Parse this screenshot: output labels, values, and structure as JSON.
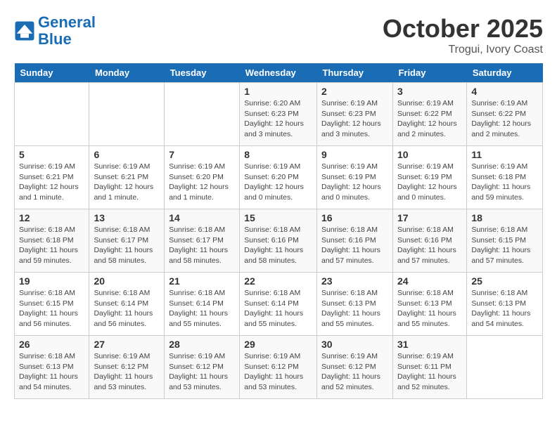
{
  "header": {
    "logo_line1": "General",
    "logo_line2": "Blue",
    "month": "October 2025",
    "location": "Trogui, Ivory Coast"
  },
  "weekdays": [
    "Sunday",
    "Monday",
    "Tuesday",
    "Wednesday",
    "Thursday",
    "Friday",
    "Saturday"
  ],
  "weeks": [
    [
      {
        "day": "",
        "info": ""
      },
      {
        "day": "",
        "info": ""
      },
      {
        "day": "",
        "info": ""
      },
      {
        "day": "1",
        "info": "Sunrise: 6:20 AM\nSunset: 6:23 PM\nDaylight: 12 hours\nand 3 minutes."
      },
      {
        "day": "2",
        "info": "Sunrise: 6:19 AM\nSunset: 6:23 PM\nDaylight: 12 hours\nand 3 minutes."
      },
      {
        "day": "3",
        "info": "Sunrise: 6:19 AM\nSunset: 6:22 PM\nDaylight: 12 hours\nand 2 minutes."
      },
      {
        "day": "4",
        "info": "Sunrise: 6:19 AM\nSunset: 6:22 PM\nDaylight: 12 hours\nand 2 minutes."
      }
    ],
    [
      {
        "day": "5",
        "info": "Sunrise: 6:19 AM\nSunset: 6:21 PM\nDaylight: 12 hours\nand 1 minute."
      },
      {
        "day": "6",
        "info": "Sunrise: 6:19 AM\nSunset: 6:21 PM\nDaylight: 12 hours\nand 1 minute."
      },
      {
        "day": "7",
        "info": "Sunrise: 6:19 AM\nSunset: 6:20 PM\nDaylight: 12 hours\nand 1 minute."
      },
      {
        "day": "8",
        "info": "Sunrise: 6:19 AM\nSunset: 6:20 PM\nDaylight: 12 hours\nand 0 minutes."
      },
      {
        "day": "9",
        "info": "Sunrise: 6:19 AM\nSunset: 6:19 PM\nDaylight: 12 hours\nand 0 minutes."
      },
      {
        "day": "10",
        "info": "Sunrise: 6:19 AM\nSunset: 6:19 PM\nDaylight: 12 hours\nand 0 minutes."
      },
      {
        "day": "11",
        "info": "Sunrise: 6:19 AM\nSunset: 6:18 PM\nDaylight: 11 hours\nand 59 minutes."
      }
    ],
    [
      {
        "day": "12",
        "info": "Sunrise: 6:18 AM\nSunset: 6:18 PM\nDaylight: 11 hours\nand 59 minutes."
      },
      {
        "day": "13",
        "info": "Sunrise: 6:18 AM\nSunset: 6:17 PM\nDaylight: 11 hours\nand 58 minutes."
      },
      {
        "day": "14",
        "info": "Sunrise: 6:18 AM\nSunset: 6:17 PM\nDaylight: 11 hours\nand 58 minutes."
      },
      {
        "day": "15",
        "info": "Sunrise: 6:18 AM\nSunset: 6:16 PM\nDaylight: 11 hours\nand 58 minutes."
      },
      {
        "day": "16",
        "info": "Sunrise: 6:18 AM\nSunset: 6:16 PM\nDaylight: 11 hours\nand 57 minutes."
      },
      {
        "day": "17",
        "info": "Sunrise: 6:18 AM\nSunset: 6:16 PM\nDaylight: 11 hours\nand 57 minutes."
      },
      {
        "day": "18",
        "info": "Sunrise: 6:18 AM\nSunset: 6:15 PM\nDaylight: 11 hours\nand 57 minutes."
      }
    ],
    [
      {
        "day": "19",
        "info": "Sunrise: 6:18 AM\nSunset: 6:15 PM\nDaylight: 11 hours\nand 56 minutes."
      },
      {
        "day": "20",
        "info": "Sunrise: 6:18 AM\nSunset: 6:14 PM\nDaylight: 11 hours\nand 56 minutes."
      },
      {
        "day": "21",
        "info": "Sunrise: 6:18 AM\nSunset: 6:14 PM\nDaylight: 11 hours\nand 55 minutes."
      },
      {
        "day": "22",
        "info": "Sunrise: 6:18 AM\nSunset: 6:14 PM\nDaylight: 11 hours\nand 55 minutes."
      },
      {
        "day": "23",
        "info": "Sunrise: 6:18 AM\nSunset: 6:13 PM\nDaylight: 11 hours\nand 55 minutes."
      },
      {
        "day": "24",
        "info": "Sunrise: 6:18 AM\nSunset: 6:13 PM\nDaylight: 11 hours\nand 55 minutes."
      },
      {
        "day": "25",
        "info": "Sunrise: 6:18 AM\nSunset: 6:13 PM\nDaylight: 11 hours\nand 54 minutes."
      }
    ],
    [
      {
        "day": "26",
        "info": "Sunrise: 6:18 AM\nSunset: 6:13 PM\nDaylight: 11 hours\nand 54 minutes."
      },
      {
        "day": "27",
        "info": "Sunrise: 6:19 AM\nSunset: 6:12 PM\nDaylight: 11 hours\nand 53 minutes."
      },
      {
        "day": "28",
        "info": "Sunrise: 6:19 AM\nSunset: 6:12 PM\nDaylight: 11 hours\nand 53 minutes."
      },
      {
        "day": "29",
        "info": "Sunrise: 6:19 AM\nSunset: 6:12 PM\nDaylight: 11 hours\nand 53 minutes."
      },
      {
        "day": "30",
        "info": "Sunrise: 6:19 AM\nSunset: 6:12 PM\nDaylight: 11 hours\nand 52 minutes."
      },
      {
        "day": "31",
        "info": "Sunrise: 6:19 AM\nSunset: 6:11 PM\nDaylight: 11 hours\nand 52 minutes."
      },
      {
        "day": "",
        "info": ""
      }
    ]
  ]
}
